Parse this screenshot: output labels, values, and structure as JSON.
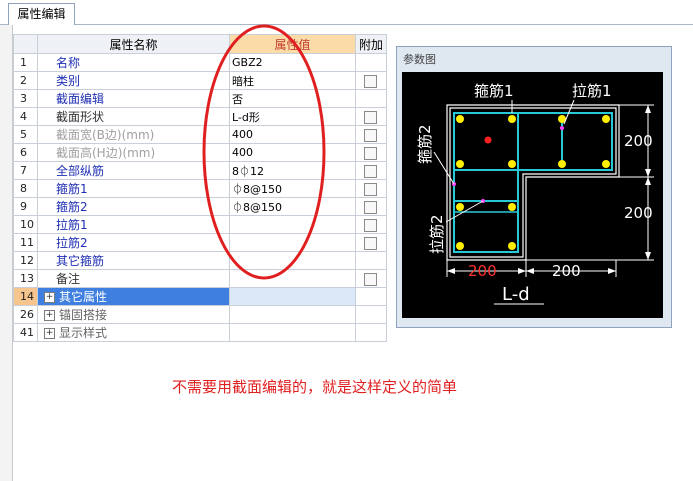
{
  "tab": {
    "label": "属性编辑"
  },
  "headers": {
    "name": "属性名称",
    "value": "属性值",
    "extra": "附加"
  },
  "rows": [
    {
      "num": "1",
      "name": "名称",
      "value": "GBZ2",
      "style": "blue",
      "check": false
    },
    {
      "num": "2",
      "name": "类别",
      "value": "暗柱",
      "style": "blue",
      "check": true
    },
    {
      "num": "3",
      "name": "截面编辑",
      "value": "否",
      "style": "blue",
      "check": false
    },
    {
      "num": "4",
      "name": "截面形状",
      "value": "L-d形",
      "style": "dark",
      "check": true
    },
    {
      "num": "5",
      "name": "截面宽(B边)(mm)",
      "value": "400",
      "style": "gray",
      "check": true
    },
    {
      "num": "6",
      "name": "截面高(H边)(mm)",
      "value": "400",
      "style": "gray",
      "check": true
    },
    {
      "num": "7",
      "name": "全部纵筋",
      "value": "8⏀12",
      "style": "blue",
      "check": true
    },
    {
      "num": "8",
      "name": "箍筋1",
      "value": "⏀8@150",
      "style": "blue",
      "check": true
    },
    {
      "num": "9",
      "name": "箍筋2",
      "value": "⏀8@150",
      "style": "blue",
      "check": true
    },
    {
      "num": "10",
      "name": "拉筋1",
      "value": "",
      "style": "blue",
      "check": true
    },
    {
      "num": "11",
      "name": "拉筋2",
      "value": "",
      "style": "blue",
      "check": true
    },
    {
      "num": "12",
      "name": "其它箍筋",
      "value": "",
      "style": "blue",
      "check": false
    },
    {
      "num": "13",
      "name": "备注",
      "value": "",
      "style": "dark",
      "check": true
    }
  ],
  "groups": [
    {
      "num": "14",
      "name": "其它属性",
      "selected": true
    },
    {
      "num": "26",
      "name": "锚固搭接",
      "selected": false
    },
    {
      "num": "41",
      "name": "显示样式",
      "selected": false
    }
  ],
  "panel": {
    "title": "参数图",
    "labels": {
      "stirrup1": "箍筋1",
      "tie1": "拉筋1",
      "stirrup2": "箍筋2",
      "tie2": "拉筋2",
      "dim_right_top": "200",
      "dim_right_bottom": "200",
      "dim_bottom_left": "200",
      "dim_bottom_right": "200",
      "shape": "L-d"
    }
  },
  "note": "不需要用截面编辑的，就是这样定义的简单",
  "colors": {
    "annotation": "#e02020",
    "selection": "#3f7fe0",
    "rebar": "#ffee00",
    "stirrup": "#27c9d6"
  }
}
